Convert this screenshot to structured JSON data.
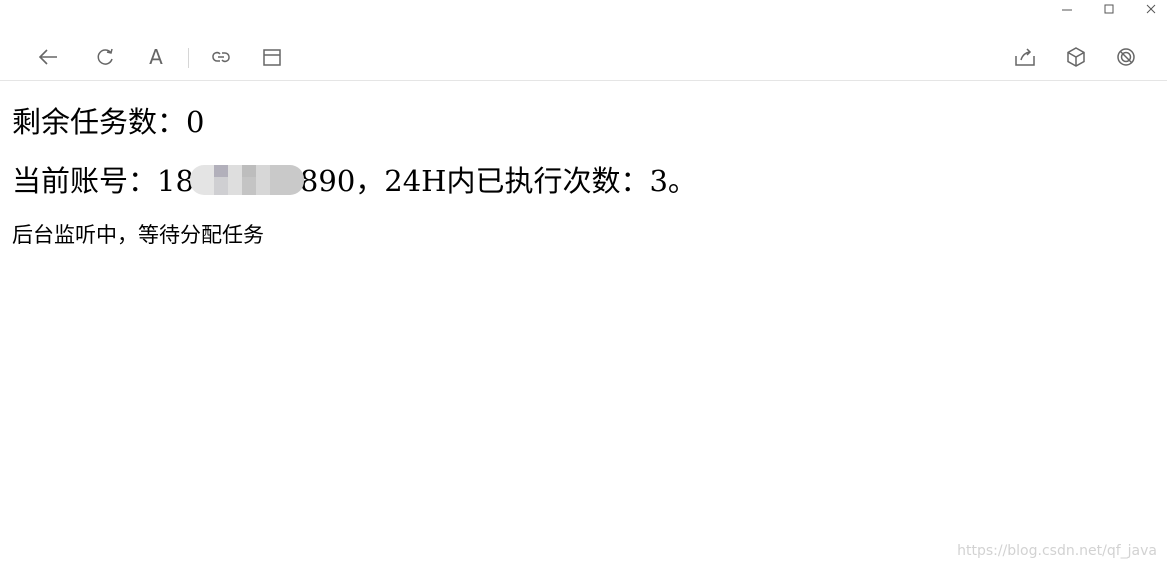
{
  "toolbar": {
    "left_icons": [
      "back-arrow-icon",
      "refresh-icon",
      "font-icon",
      "link-icon",
      "window-icon"
    ],
    "right_icons": [
      "share-icon",
      "cube-icon",
      "block-icon"
    ],
    "font_glyph": "A"
  },
  "content": {
    "remaining_label": "剩余任务数：",
    "remaining_value": "0",
    "account_label": "当前账号：",
    "account_prefix": "18",
    "account_suffix": "890",
    "exec_text": "，24H内已执行次数：3。",
    "status_text": "后台监听中，等待分配任务"
  },
  "watermark": "https://blog.csdn.net/qf_java",
  "colors": {
    "icon": "#666666",
    "divider": "#e5e5e5",
    "text": "#000000",
    "watermark": "#d2d2d2"
  }
}
